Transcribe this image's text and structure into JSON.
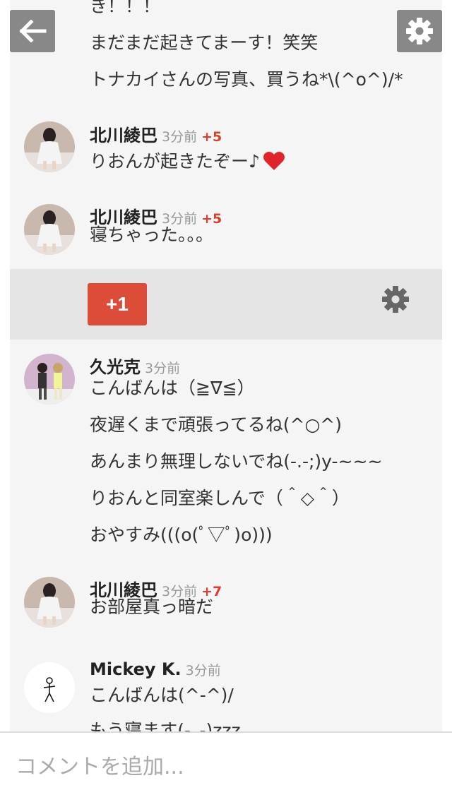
{
  "post_tail": [
    "き！！！",
    "まだまだ起きてまーす！笑笑",
    "トナカイさんの写真、買うね*\\(^o^)/*"
  ],
  "comments_before": [
    {
      "author": "北川綾巴",
      "time": "3分前",
      "plus": "+5",
      "lines": [
        "りおんが起きたぞー♪"
      ],
      "emoji": "heart"
    },
    {
      "author": "北川綾巴",
      "time": "3分前",
      "plus": "+5",
      "lines": [
        "寝ちゃった。。。"
      ]
    }
  ],
  "action_bar": {
    "plus_one_label": "+1",
    "gear_icon": "gear-icon"
  },
  "comments_after": [
    {
      "author": "久光克",
      "time": "3分前",
      "plus": "",
      "lines": [
        "こんばんは（≧∇≦）",
        "夜遅くまで頑張ってるね(^○^)",
        "あんまり無理しないでね(-.-;)y-~~~",
        "りおんと同室楽しんで（＾◇＾）",
        "おやすみ(((o(ﾟ▽ﾟ)o)))"
      ]
    },
    {
      "author": "北川綾巴",
      "time": "3分前",
      "plus": "+7",
      "lines": [
        "お部屋真っ暗だ"
      ]
    },
    {
      "author": "Mickey K.",
      "time": "3分前",
      "plus": "",
      "lines": [
        "こんばんは(^-^)/",
        "もう寝ます(-_-)zzz"
      ]
    }
  ],
  "top_buttons": {
    "back_icon": "back-arrow-icon",
    "settings_icon": "gear-icon"
  },
  "composer": {
    "placeholder": "コメントを追加..."
  },
  "colors": {
    "accent_red": "#dd4b39",
    "plus_text": "#d9412e",
    "stream_bg": "#f5f5f5",
    "bar_bg": "#e5e5e5"
  }
}
